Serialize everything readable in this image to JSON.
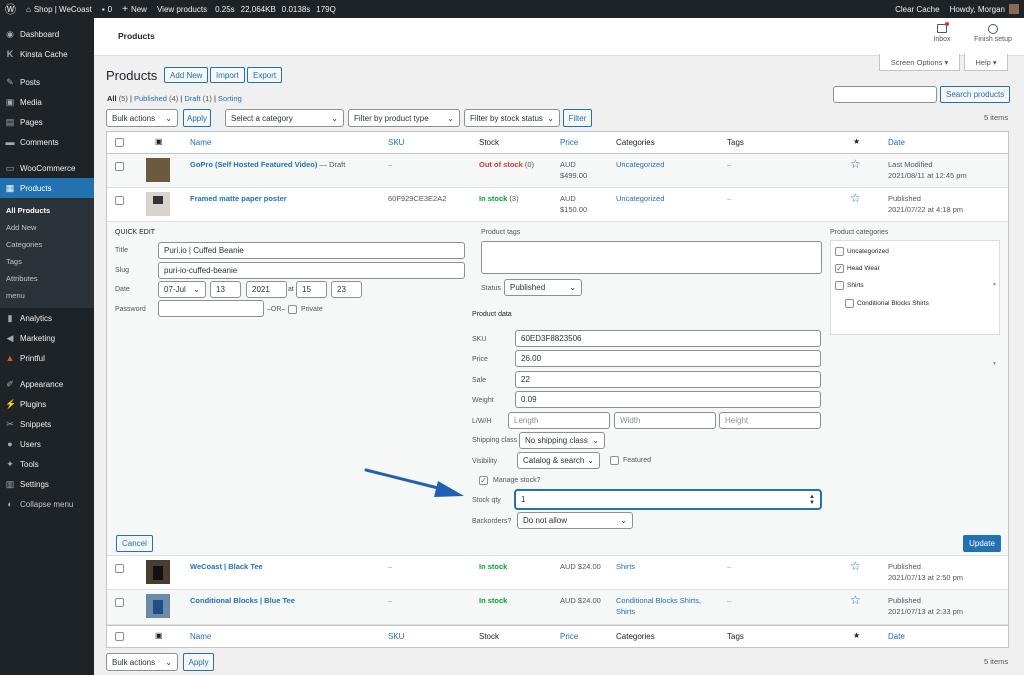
{
  "adminbar": {
    "site": "Shop | WeCoast",
    "comments": "0",
    "new": "New",
    "view": "View products",
    "stat1": "0.25s",
    "stat2": "22,064KB",
    "stat3": "0.0138s",
    "stat4": "179Q",
    "clear_cache": "Clear Cache",
    "howdy": "Howdy, Morgan"
  },
  "sidebar": {
    "items": [
      "Dashboard",
      "Kinsta Cache",
      "Posts",
      "Media",
      "Pages",
      "Comments",
      "WooCommerce",
      "Products",
      "Analytics",
      "Marketing",
      "Printful",
      "Appearance",
      "Plugins",
      "Snippets",
      "Users",
      "Tools",
      "Settings",
      "Collapse menu"
    ],
    "sub": [
      "All Products",
      "Add New",
      "Categories",
      "Tags",
      "Attributes",
      "menu"
    ]
  },
  "header": {
    "crumb": "Products",
    "inbox": "Inbox",
    "finish": "Finish setup",
    "screen_options": "Screen Options ▾",
    "help": "Help ▾"
  },
  "page": {
    "title": "Products",
    "add_new": "Add New",
    "import": "Import",
    "export": "Export",
    "filters": {
      "all": "All",
      "all_count": "(5)",
      "published": "Published",
      "published_count": "(4)",
      "draft": "Draft",
      "draft_count": "(1)",
      "sorting": "Sorting"
    },
    "search_btn": "Search products",
    "bulk": "Bulk actions",
    "apply": "Apply",
    "category": "Select a category",
    "type": "Filter by product type",
    "stock": "Filter by stock status",
    "filter": "Filter",
    "items": "5 items"
  },
  "columns": {
    "name": "Name",
    "sku": "SKU",
    "stock": "Stock",
    "price": "Price",
    "categories": "Categories",
    "tags": "Tags",
    "date": "Date",
    "star": "★"
  },
  "rows": [
    {
      "name": "GoPro (Self Hosted Featured Video)",
      "suffix": "— Draft",
      "sku": "–",
      "stock": "Out of stock",
      "stock_count": "(0)",
      "price1": "AUD",
      "price2": "$499.00",
      "cat1": "Uncategorized",
      "cat2": "",
      "tags": "–",
      "date1": "Last Modified",
      "date2": "2021/08/11 at 12:45 pm"
    },
    {
      "name": "Framed matte paper poster",
      "suffix": "",
      "sku": "60F929CE3E2A2",
      "stock": "In stock",
      "stock_count": "(3)",
      "price1": "AUD",
      "price2": "$150.00",
      "cat1": "Uncategorized",
      "cat2": "",
      "tags": "–",
      "date1": "Published",
      "date2": "2021/07/22 at 4:18 pm"
    },
    {
      "name": "WeCoast | Black Tee",
      "suffix": "",
      "sku": "–",
      "stock": "In stock",
      "stock_count": "",
      "price1": "AUD $24.00",
      "price2": "",
      "cat1": "Shirts",
      "cat2": "",
      "tags": "–",
      "date1": "Published",
      "date2": "2021/07/13 at 2:50 pm"
    },
    {
      "name": "Conditional Blocks | Blue Tee",
      "suffix": "",
      "sku": "–",
      "stock": "In stock",
      "stock_count": "",
      "price1": "AUD $24.00",
      "price2": "",
      "cat1": "Conditional Blocks Shirts,",
      "cat2": "Shirts",
      "tags": "–",
      "date1": "Published",
      "date2": "2021/07/13 at 2:33 pm"
    }
  ],
  "quickedit": {
    "heading": "QUICK EDIT",
    "title_label": "Title",
    "title": "Puri.io | Cuffed Beanie",
    "slug_label": "Slug",
    "slug": "puri-io-cuffed-beanie",
    "date_label": "Date",
    "month": "07-Jul",
    "day": "13",
    "year": "2021",
    "at": "at",
    "hour": "15",
    "min": "23",
    "password_label": "Password",
    "or": "–OR–",
    "private": "Private",
    "tags_label": "Product tags",
    "status_label": "Status",
    "status": "Published",
    "product_data": "Product data",
    "sku_label": "SKU",
    "sku": "60ED3F8823506",
    "price_label": "Price",
    "price": "26.00",
    "sale_label": "Sale",
    "sale": "22",
    "weight_label": "Weight",
    "weight": "0.09",
    "lwh_label": "L/W/H",
    "length_ph": "Length",
    "width_ph": "Width",
    "height_ph": "Height",
    "shipping_label": "Shipping class",
    "shipping": "No shipping class",
    "visibility_label": "Visibility",
    "visibility": "Catalog & search",
    "featured": "Featured",
    "manage_stock": "Manage stock?",
    "qty_label": "Stock qty",
    "qty": "1",
    "backorders_label": "Backorders?",
    "backorders": "Do not allow",
    "cats_label": "Product categories",
    "cats": [
      "Uncategorized",
      "Head Wear",
      "Shirts",
      "Conditional Blocks Shirts"
    ],
    "cancel": "Cancel",
    "update": "Update"
  },
  "colors": {
    "accent": "#2271b1",
    "sidebar": "#1d2327",
    "instock": "#00a32a",
    "outstock": "#d63638"
  }
}
